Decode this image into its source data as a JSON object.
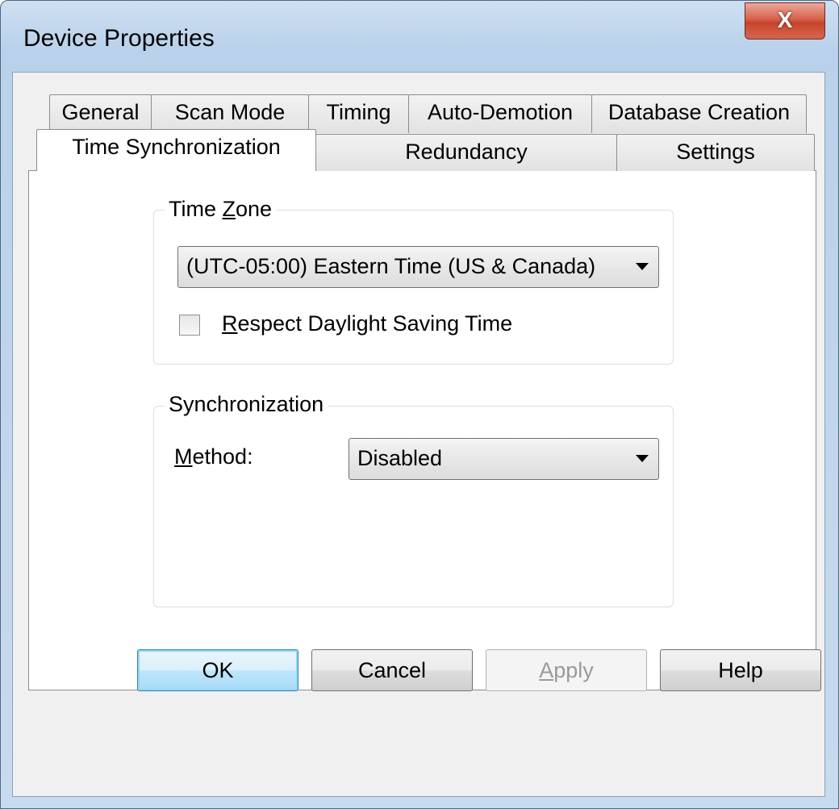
{
  "window": {
    "title": "Device Properties",
    "close_glyph": "X"
  },
  "tabs_row1": [
    "General",
    "Scan Mode",
    "Timing",
    "Auto-Demotion",
    "Database Creation"
  ],
  "tabs_row2": [
    "Time Synchronization",
    "Redundancy",
    "Settings"
  ],
  "active_tab": "Time Synchronization",
  "time_zone": {
    "label_pre": "Time ",
    "label_accel": "Z",
    "label_post": "one",
    "selected": "(UTC-05:00) Eastern Time (US & Canada)",
    "dst_label_accel": "R",
    "dst_label_rest": "espect Daylight Saving Time",
    "dst_checked": false
  },
  "synchronization": {
    "label": "Synchronization",
    "method_accel": "M",
    "method_rest": "ethod:",
    "method_value": "Disabled"
  },
  "buttons": {
    "ok": "OK",
    "cancel": "Cancel",
    "apply_accel": "A",
    "apply_rest": "pply",
    "help": "Help"
  },
  "icons": [
    "close-icon",
    "dropdown-arrow-icon",
    "checkbox-unchecked"
  ]
}
